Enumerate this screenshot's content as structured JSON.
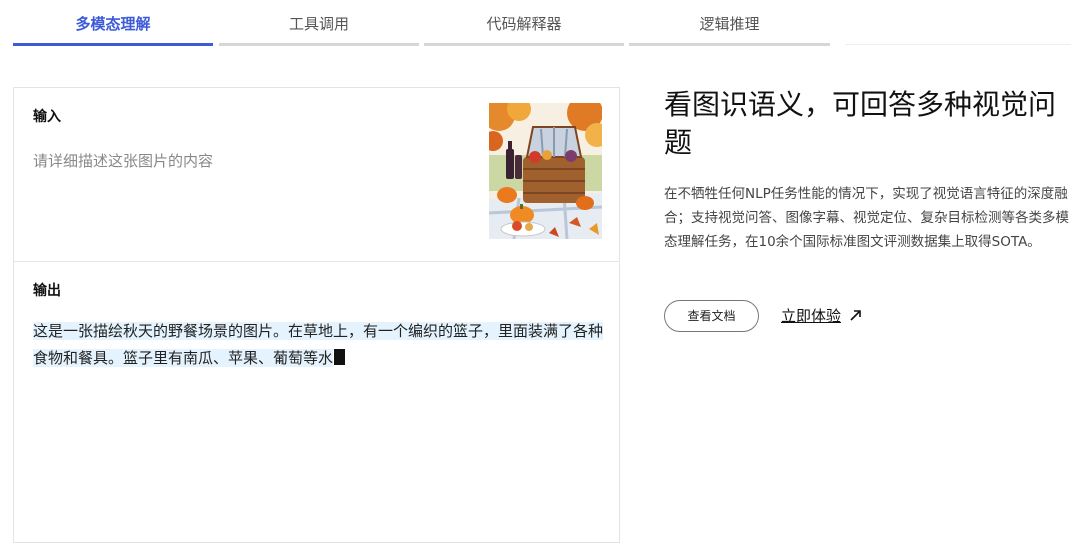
{
  "tabs": [
    {
      "label": "多模态理解",
      "active": true
    },
    {
      "label": "工具调用",
      "active": false
    },
    {
      "label": "代码解释器",
      "active": false
    },
    {
      "label": "逻辑推理",
      "active": false
    }
  ],
  "input": {
    "title": "输入",
    "prompt": "请详细描述这张图片的内容",
    "image_alt": "autumn picnic basket illustration"
  },
  "output": {
    "title": "输出",
    "text": "这是一张描绘秋天的野餐场景的图片。在草地上，有一个编织的篮子，里面装满了各种食物和餐具。篮子里有南瓜、苹果、葡萄等水"
  },
  "feature": {
    "headline": "看图识语义，可回答多种视觉问题",
    "description": "在不牺牲任何NLP任务性能的情况下，实现了视觉语言特征的深度融合；支持视觉问答、图像字幕、视觉定位、复杂目标检测等各类多模态理解任务，在10余个国际标准图文评测数据集上取得SOTA。",
    "doc_button": "查看文档",
    "try_link": "立即体验"
  },
  "colors": {
    "accent": "#3d5bd9",
    "highlight": "#e4f3fd"
  }
}
